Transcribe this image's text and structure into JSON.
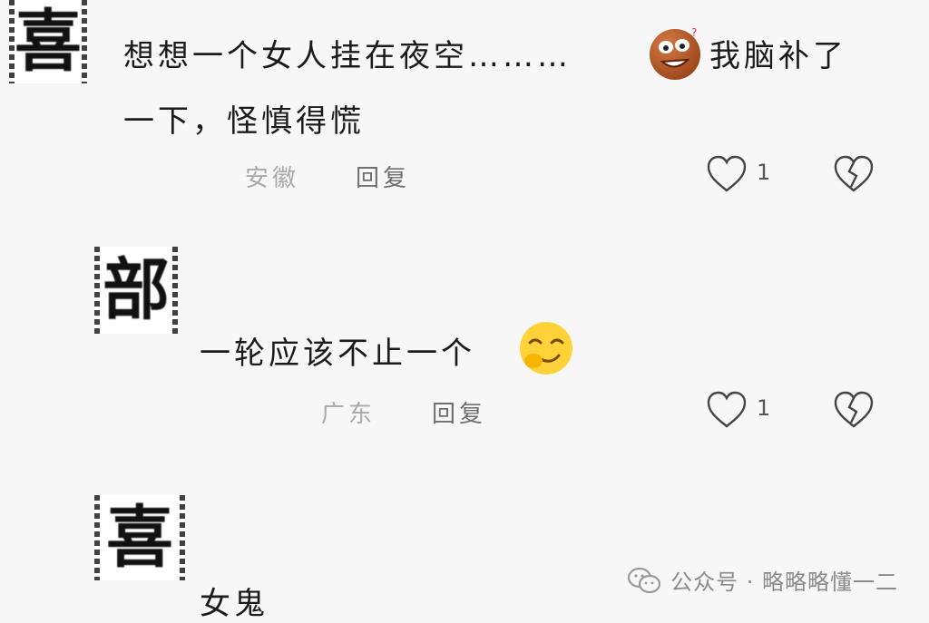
{
  "comments": [
    {
      "avatar_glyph": "喜",
      "text_line1": "想想一个女人挂在夜空………",
      "text_line1_after_emoji": "我脑补了",
      "text_line2": "一下，怪慎得慌",
      "emoji": "surprised-face-emoji",
      "location": "安徽",
      "reply_label": "回复",
      "likes": "1"
    },
    {
      "avatar_glyph": "部",
      "text_line1": "一轮应该不止一个",
      "emoji": "smirk-face-emoji",
      "location": "广东",
      "reply_label": "回复",
      "likes": "1"
    },
    {
      "avatar_glyph": "喜",
      "text_line1": "女鬼"
    }
  ],
  "watermark": {
    "icon": "wechat-icon",
    "text": "公众号 · 略略略懂一二"
  }
}
